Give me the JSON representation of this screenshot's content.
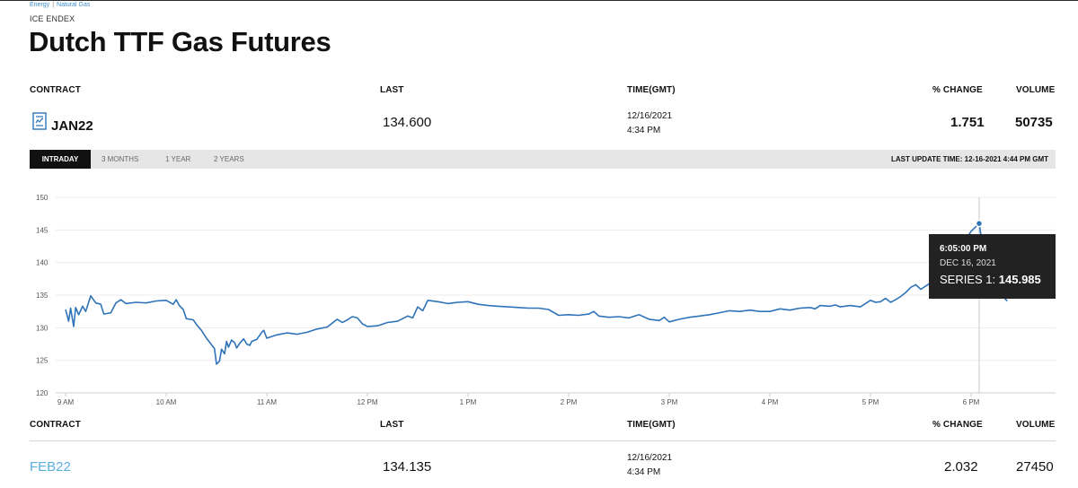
{
  "breadcrumb": {
    "items": [
      "Energy",
      "Natural Gas"
    ],
    "separator": "|"
  },
  "source": "ICE ENDEX",
  "title": "Dutch TTF Gas Futures",
  "columns": {
    "contract": "CONTRACT",
    "last": "LAST",
    "time": "TIME(GMT)",
    "change": "% CHANGE",
    "volume": "VOLUME"
  },
  "rows": [
    {
      "contract": "JAN22",
      "last": "134.600",
      "date": "12/16/2021",
      "time": "4:34 PM",
      "change": "1.751",
      "volume": "50735",
      "icon": "document-chart-icon"
    },
    {
      "contract": "FEB22",
      "last": "134.135",
      "date": "12/16/2021",
      "time": "4:34 PM",
      "change": "2.032",
      "volume": "27450"
    }
  ],
  "tabs": [
    {
      "label": "INTRADAY",
      "active": true
    },
    {
      "label": "3 MONTHS",
      "active": false
    },
    {
      "label": "1 YEAR",
      "active": false
    },
    {
      "label": "2 YEARS",
      "active": false
    }
  ],
  "last_update": "LAST UPDATE TIME: 12-16-2021 4:44 PM GMT",
  "tooltip": {
    "time": "6:05:00 PM",
    "date": "DEC 16, 2021",
    "series_label": "SERIES 1:",
    "series_value": "145.985"
  },
  "colors": {
    "line": "#2f73b8",
    "accent_link": "#5aaee0",
    "tab_active": "#111111",
    "tab_bar": "#e6e6e6",
    "tooltip_bg": "#222222"
  },
  "chart_data": {
    "type": "line",
    "title": "",
    "xlabel": "",
    "ylabel": "",
    "ylim": [
      120,
      150
    ],
    "yticks": [
      120,
      125,
      130,
      135,
      140,
      145,
      150
    ],
    "xticks": [
      "9 AM",
      "10 AM",
      "11 AM",
      "12 PM",
      "1 PM",
      "2 PM",
      "3 PM",
      "4 PM",
      "5 PM",
      "6 PM"
    ],
    "grid": true,
    "legend": "none",
    "series": [
      {
        "values": [
          [
            9.0,
            132.8
          ],
          [
            9.03,
            131.0
          ],
          [
            9.05,
            133.0
          ],
          [
            9.08,
            130.2
          ],
          [
            9.1,
            133.1
          ],
          [
            9.13,
            132.0
          ],
          [
            9.17,
            133.3
          ],
          [
            9.2,
            132.5
          ],
          [
            9.25,
            134.9
          ],
          [
            9.3,
            133.8
          ],
          [
            9.35,
            133.6
          ],
          [
            9.38,
            132.1
          ],
          [
            9.45,
            132.3
          ],
          [
            9.5,
            133.8
          ],
          [
            9.55,
            134.3
          ],
          [
            9.6,
            133.7
          ],
          [
            9.7,
            133.9
          ],
          [
            9.8,
            133.8
          ],
          [
            9.9,
            134.1
          ],
          [
            10.0,
            134.2
          ],
          [
            10.07,
            133.6
          ],
          [
            10.1,
            134.3
          ],
          [
            10.13,
            133.4
          ],
          [
            10.17,
            132.8
          ],
          [
            10.2,
            131.4
          ],
          [
            10.27,
            131.2
          ],
          [
            10.3,
            130.5
          ],
          [
            10.35,
            129.6
          ],
          [
            10.4,
            128.4
          ],
          [
            10.45,
            127.4
          ],
          [
            10.48,
            126.8
          ],
          [
            10.5,
            124.4
          ],
          [
            10.53,
            124.9
          ],
          [
            10.55,
            126.7
          ],
          [
            10.58,
            126.0
          ],
          [
            10.6,
            127.9
          ],
          [
            10.62,
            127.0
          ],
          [
            10.65,
            128.1
          ],
          [
            10.68,
            127.7
          ],
          [
            10.7,
            126.9
          ],
          [
            10.73,
            127.6
          ],
          [
            10.77,
            128.3
          ],
          [
            10.8,
            127.5
          ],
          [
            10.83,
            127.3
          ],
          [
            10.85,
            127.9
          ],
          [
            10.9,
            128.2
          ],
          [
            10.95,
            129.3
          ],
          [
            10.97,
            129.6
          ],
          [
            11.0,
            128.4
          ],
          [
            11.1,
            128.9
          ],
          [
            11.2,
            129.2
          ],
          [
            11.3,
            129.0
          ],
          [
            11.4,
            129.3
          ],
          [
            11.5,
            129.8
          ],
          [
            11.6,
            130.1
          ],
          [
            11.7,
            131.3
          ],
          [
            11.75,
            130.8
          ],
          [
            11.8,
            131.2
          ],
          [
            11.85,
            131.7
          ],
          [
            11.9,
            131.5
          ],
          [
            11.95,
            130.6
          ],
          [
            12.0,
            130.2
          ],
          [
            12.1,
            130.3
          ],
          [
            12.2,
            130.8
          ],
          [
            12.3,
            131.0
          ],
          [
            12.4,
            131.8
          ],
          [
            12.45,
            131.5
          ],
          [
            12.5,
            133.2
          ],
          [
            12.55,
            132.6
          ],
          [
            12.6,
            134.2
          ],
          [
            12.7,
            134.0
          ],
          [
            12.8,
            133.7
          ],
          [
            12.9,
            133.9
          ],
          [
            13.0,
            134.0
          ],
          [
            13.1,
            133.6
          ],
          [
            13.2,
            133.4
          ],
          [
            13.3,
            133.3
          ],
          [
            13.4,
            133.2
          ],
          [
            13.5,
            133.1
          ],
          [
            13.6,
            133.0
          ],
          [
            13.7,
            133.0
          ],
          [
            13.8,
            132.8
          ],
          [
            13.9,
            131.9
          ],
          [
            14.0,
            132.0
          ],
          [
            14.1,
            131.9
          ],
          [
            14.2,
            132.1
          ],
          [
            14.25,
            132.5
          ],
          [
            14.3,
            131.8
          ],
          [
            14.4,
            131.6
          ],
          [
            14.5,
            131.7
          ],
          [
            14.6,
            131.5
          ],
          [
            14.7,
            132.0
          ],
          [
            14.8,
            131.3
          ],
          [
            14.9,
            131.1
          ],
          [
            14.95,
            131.6
          ],
          [
            15.0,
            130.9
          ],
          [
            15.1,
            131.3
          ],
          [
            15.2,
            131.6
          ],
          [
            15.3,
            131.8
          ],
          [
            15.4,
            132.0
          ],
          [
            15.5,
            132.3
          ],
          [
            15.6,
            132.6
          ],
          [
            15.7,
            132.5
          ],
          [
            15.8,
            132.7
          ],
          [
            15.9,
            132.5
          ],
          [
            16.0,
            132.5
          ],
          [
            16.1,
            132.9
          ],
          [
            16.2,
            132.7
          ],
          [
            16.3,
            133.0
          ],
          [
            16.4,
            133.1
          ],
          [
            16.45,
            132.9
          ],
          [
            16.5,
            133.4
          ],
          [
            16.6,
            133.3
          ],
          [
            16.65,
            133.5
          ],
          [
            16.7,
            133.2
          ],
          [
            16.8,
            133.4
          ],
          [
            16.9,
            133.2
          ],
          [
            17.0,
            134.2
          ],
          [
            17.05,
            133.9
          ],
          [
            17.1,
            134.0
          ],
          [
            17.15,
            134.5
          ],
          [
            17.2,
            133.9
          ],
          [
            17.25,
            134.3
          ],
          [
            17.3,
            134.8
          ],
          [
            17.35,
            135.4
          ],
          [
            17.4,
            136.2
          ],
          [
            17.45,
            136.6
          ],
          [
            17.5,
            135.9
          ],
          [
            17.55,
            136.4
          ],
          [
            17.6,
            136.9
          ],
          [
            17.65,
            137.5
          ],
          [
            17.7,
            138.7
          ],
          [
            17.75,
            139.4
          ],
          [
            17.8,
            140.0
          ],
          [
            17.85,
            141.0
          ],
          [
            17.9,
            142.0
          ],
          [
            17.95,
            143.6
          ],
          [
            18.0,
            144.8
          ],
          [
            18.08,
            145.985
          ],
          [
            18.12,
            142.0
          ],
          [
            18.2,
            138.0
          ],
          [
            18.3,
            135.0
          ],
          [
            18.36,
            134.1
          ]
        ]
      }
    ]
  }
}
